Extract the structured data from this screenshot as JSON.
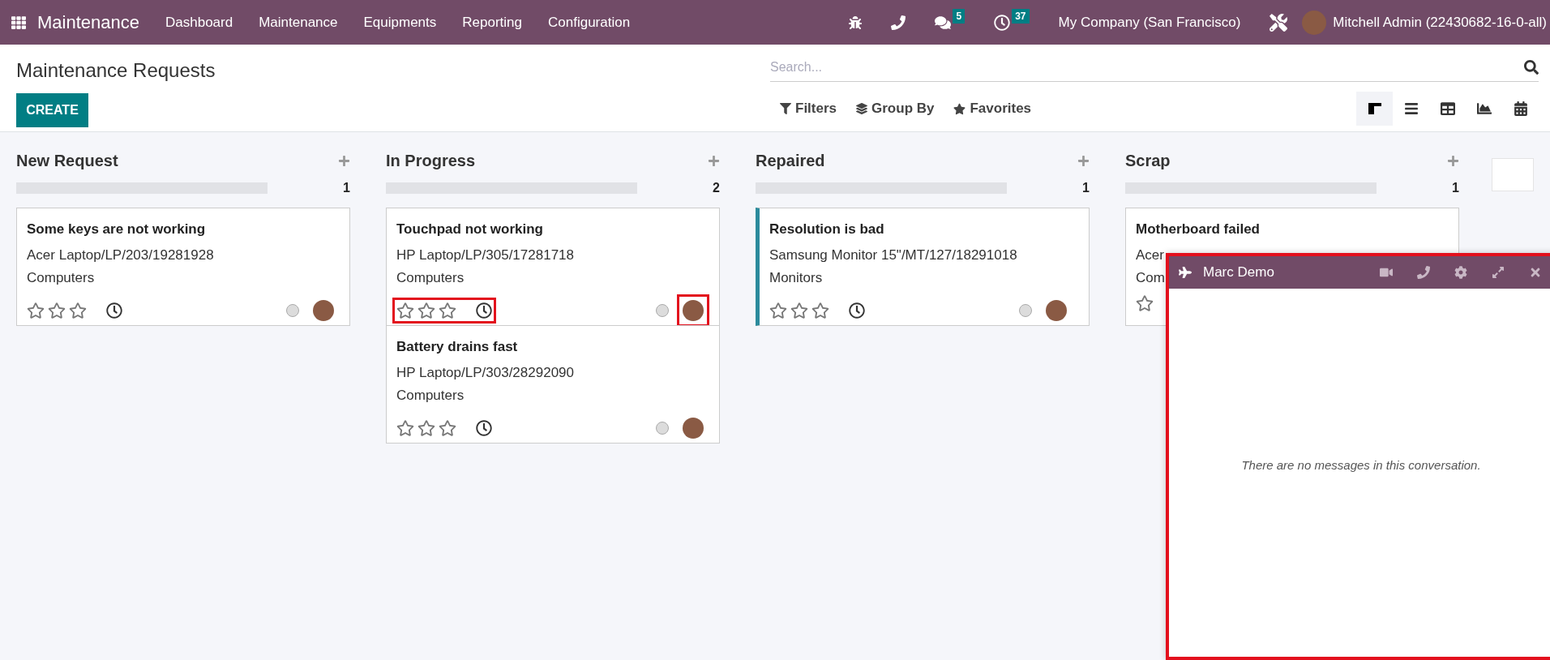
{
  "navbar": {
    "app_name": "Maintenance",
    "menu": [
      "Dashboard",
      "Maintenance",
      "Equipments",
      "Reporting",
      "Configuration"
    ],
    "messages_count": "5",
    "activities_count": "37",
    "company": "My Company (San Francisco)",
    "user": "Mitchell Admin (22430682-16-0-all)"
  },
  "control_panel": {
    "title": "Maintenance Requests",
    "create_label": "CREATE",
    "search": {
      "placeholder": "Search..."
    },
    "filters": [
      "Filters",
      "Group By",
      "Favorites"
    ],
    "views": [
      {
        "kind": "kanban",
        "selected": true
      },
      {
        "kind": "list",
        "selected": false
      },
      {
        "kind": "pivot",
        "selected": false
      },
      {
        "kind": "graph",
        "selected": false
      },
      {
        "kind": "calendar",
        "selected": false
      }
    ]
  },
  "columns": [
    {
      "title": "New Request",
      "count": "1",
      "level": 0,
      "cards": [
        {
          "title": "Some keys are not working",
          "equipment": "Acer Laptop/LP/203/19281928",
          "category": "Computers",
          "stars": 0,
          "rating_highlighted": false,
          "avatar_highlighted": false
        }
      ]
    },
    {
      "title": "In Progress",
      "count": "2",
      "level": 0,
      "cards": [
        {
          "title": "Touchpad not working",
          "equipment": "HP Laptop/LP/305/17281718",
          "category": "Computers",
          "stars": 0,
          "rating_highlighted": true,
          "avatar_highlighted": true
        },
        {
          "title": "Battery drains fast",
          "equipment": "HP Laptop/LP/303/28292090",
          "category": "Computers",
          "stars": 0,
          "rating_highlighted": false,
          "avatar_highlighted": false
        }
      ]
    },
    {
      "title": "Repaired",
      "count": "1",
      "level": 0,
      "cards": [
        {
          "title": "Resolution is bad",
          "equipment": "Samsung Monitor 15\"/MT/127/18291018",
          "category": "Monitors",
          "stars": 0,
          "color": "#2b8b9c",
          "rating_highlighted": false,
          "avatar_highlighted": false
        }
      ]
    },
    {
      "title": "Scrap",
      "count": "1",
      "level": 0,
      "cards": [
        {
          "title": "Motherboard failed",
          "equipment": "Acer",
          "category": "Com",
          "rating_highlighted": false,
          "covered_by_chat": true
        }
      ]
    }
  ],
  "chat_window": {
    "title": "Marc Demo",
    "empty_message": "There are no messages in this conversation.",
    "highlighted": true
  }
}
